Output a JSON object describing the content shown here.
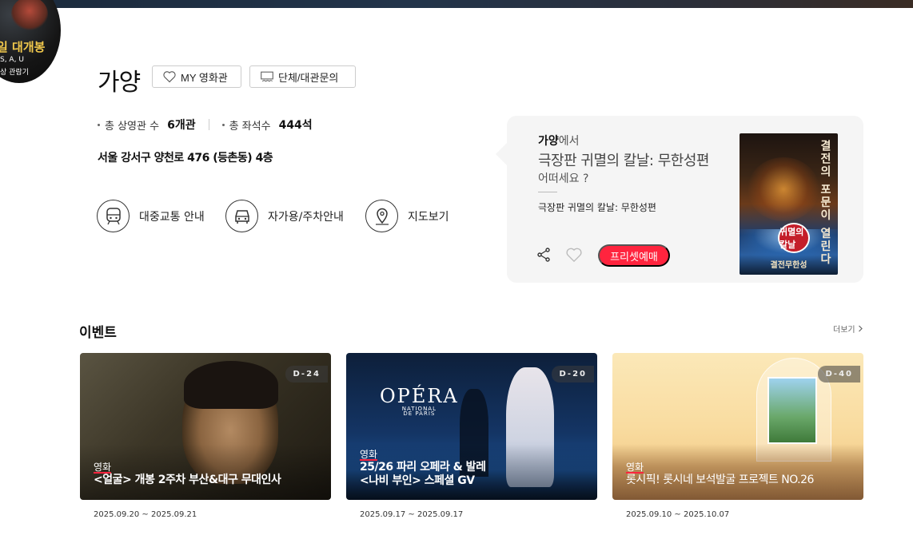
{
  "badge": {
    "title": "일 대개봉",
    "sub1": "S, A, U",
    "sub2": "상 관람기"
  },
  "theater": {
    "name": "가양",
    "my_theater_label": "MY 영화관",
    "group_inquiry_label": "단체/대관문의",
    "screens_label": "총 상영관 수",
    "screens_value": "6개관",
    "seats_label": "총 좌석수",
    "seats_value": "444석",
    "address": "서울 강서구 양천로 476 (등촌동) 4층",
    "guides": [
      {
        "label": "대중교통 안내",
        "icon": "train-icon"
      },
      {
        "label": "자가용/주차안내",
        "icon": "car-icon"
      },
      {
        "label": "지도보기",
        "icon": "map-pin-icon"
      }
    ]
  },
  "promo": {
    "theater_bold": "가양",
    "theater_suffix": "에서",
    "movie_title": "극장판 귀멸의 칼날: 무한성편",
    "question": "어떠세요 ?",
    "movie_small": "극장판 귀멸의 칼날: 무한성편",
    "preset_button": "프리셋예매",
    "poster": {
      "vertical_text": "결전의 포문이 열린다",
      "logo_text": "귀멸의 칼날",
      "footer": "결전무한성"
    }
  },
  "events": {
    "title": "이벤트",
    "more_label": "더보기",
    "cards": [
      {
        "dday": "D-24",
        "category": "영화",
        "title_line1": "<얼굴> 개봉 2주차 부산&대구 무대인사",
        "title_line2": "",
        "date": "2025.09.20 ~ 2025.09.21"
      },
      {
        "dday": "D-20",
        "category": "영화",
        "title_line1": "25/26 파리 오페라 & 발레",
        "title_line2": "<나비 부인> 스페셜 GV",
        "date": "2025.09.17 ~ 2025.09.17",
        "logo_main": "OPÉRA",
        "logo_sub1": "NATIONAL",
        "logo_sub2": "DE PARIS"
      },
      {
        "dday": "D-40",
        "category": "영화",
        "title_line1": "롯시픽! 롯시네 보석발굴 프로젝트 NO.26",
        "title_line2": "",
        "date": "2025.09.10 ~ 2025.10.07"
      }
    ]
  },
  "colors": {
    "accent": "#ff243e",
    "panel_bg": "#f5f5f5"
  }
}
